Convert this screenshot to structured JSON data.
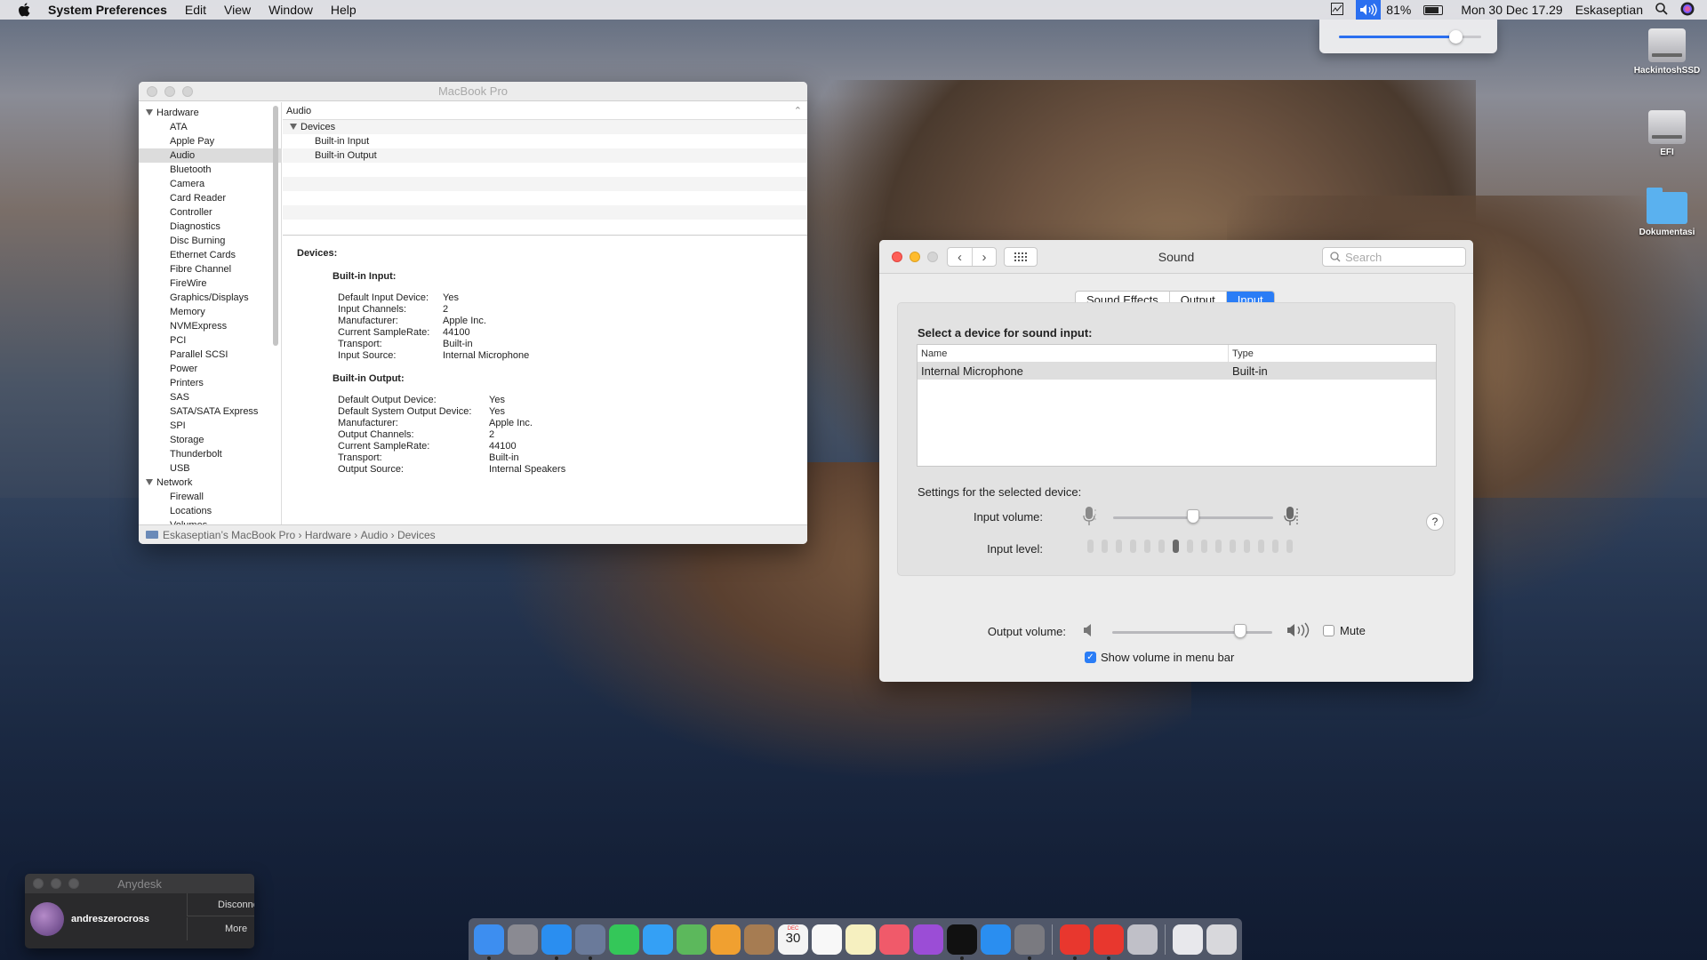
{
  "menubar": {
    "app": "System Preferences",
    "items": [
      "Edit",
      "View",
      "Window",
      "Help"
    ],
    "battery": "81%",
    "datetime": "Mon 30 Dec  17.29",
    "user": "Eskaseptian",
    "volume_level": 0.82
  },
  "desktop": {
    "icons": [
      "HackintoshSSD",
      "EFI",
      "Dokumentasi"
    ]
  },
  "sysinfo": {
    "title": "MacBook Pro",
    "sidebar": {
      "hardware_group": "Hardware",
      "hardware_items": [
        "ATA",
        "Apple Pay",
        "Audio",
        "Bluetooth",
        "Camera",
        "Card Reader",
        "Controller",
        "Diagnostics",
        "Disc Burning",
        "Ethernet Cards",
        "Fibre Channel",
        "FireWire",
        "Graphics/Displays",
        "Memory",
        "NVMExpress",
        "PCI",
        "Parallel SCSI",
        "Power",
        "Printers",
        "SAS",
        "SATA/SATA Express",
        "SPI",
        "Storage",
        "Thunderbolt",
        "USB"
      ],
      "network_group": "Network",
      "network_items": [
        "Firewall",
        "Locations",
        "Volumes"
      ],
      "selected": "Audio"
    },
    "list": {
      "header": "Audio",
      "group": "Devices",
      "children": [
        "Built-in Input",
        "Built-in Output"
      ]
    },
    "detail": {
      "heading": "Devices:",
      "input_title": "Built-in Input:",
      "input_rows": [
        [
          "Default Input Device:",
          "Yes"
        ],
        [
          "Input Channels:",
          "2"
        ],
        [
          "Manufacturer:",
          "Apple Inc."
        ],
        [
          "Current SampleRate:",
          "44100"
        ],
        [
          "Transport:",
          "Built-in"
        ],
        [
          "Input Source:",
          "Internal Microphone"
        ]
      ],
      "output_title": "Built-in Output:",
      "output_rows": [
        [
          "Default Output Device:",
          "Yes"
        ],
        [
          "Default System Output Device:",
          "Yes"
        ],
        [
          "Manufacturer:",
          "Apple Inc."
        ],
        [
          "Output Channels:",
          "2"
        ],
        [
          "Current SampleRate:",
          "44100"
        ],
        [
          "Transport:",
          "Built-in"
        ],
        [
          "Output Source:",
          "Internal Speakers"
        ]
      ]
    },
    "breadcrumb": [
      "Eskaseptian’s MacBook Pro",
      "Hardware",
      "Audio",
      "Devices"
    ]
  },
  "sound": {
    "title": "Sound",
    "search_placeholder": "Search",
    "tabs": [
      "Sound Effects",
      "Output",
      "Input"
    ],
    "active_tab": "Input",
    "select_heading": "Select a device for sound input:",
    "table": {
      "columns": [
        "Name",
        "Type"
      ],
      "rows": [
        [
          "Internal Microphone",
          "Built-in"
        ]
      ]
    },
    "settings_label": "Settings for the selected device:",
    "input_volume_label": "Input volume:",
    "input_volume": 0.5,
    "input_level_label": "Input level:",
    "input_level_segments": 15,
    "input_level_active": 6,
    "help": "?",
    "output_volume_label": "Output volume:",
    "output_volume": 0.8,
    "mute_label": "Mute",
    "mute_checked": false,
    "show_volume_label": "Show volume in menu bar",
    "show_volume_checked": true
  },
  "anydesk": {
    "title": "Anydesk",
    "user": "andreszerocross",
    "disconnect": "Disconnect",
    "more": "More"
  },
  "dock": {
    "apps": [
      {
        "name": "finder",
        "color": "#3d8ef0"
      },
      {
        "name": "launchpad",
        "color": "#8a8a92"
      },
      {
        "name": "safari",
        "color": "#2a8ef0"
      },
      {
        "name": "mail-preview",
        "color": "#6a7a9a"
      },
      {
        "name": "facetime",
        "color": "#34c759"
      },
      {
        "name": "messages",
        "color": "#34a0f5"
      },
      {
        "name": "maps",
        "color": "#5cb85c"
      },
      {
        "name": "photos",
        "color": "#f0a030"
      },
      {
        "name": "notes-brown",
        "color": "#a67c52"
      },
      {
        "name": "calendar",
        "color": "#f4f4f4"
      },
      {
        "name": "reminders",
        "color": "#f8f8f8"
      },
      {
        "name": "stickies",
        "color": "#f6f0c0"
      },
      {
        "name": "music",
        "color": "#f05a6a"
      },
      {
        "name": "podcasts",
        "color": "#9b4dd6"
      },
      {
        "name": "apple-tv",
        "color": "#111111"
      },
      {
        "name": "app-store",
        "color": "#2a8ef0"
      },
      {
        "name": "system-preferences",
        "color": "#7a7a80"
      },
      {
        "name": "anydesk-1",
        "color": "#e8372e"
      },
      {
        "name": "anydesk-2",
        "color": "#e8372e"
      },
      {
        "name": "automator",
        "color": "#c0c0c8"
      },
      {
        "name": "documents",
        "color": "#e8e8ec"
      },
      {
        "name": "trash",
        "color": "#d8d8dc"
      }
    ],
    "calendar_day": "30",
    "calendar_month": "DEC"
  }
}
